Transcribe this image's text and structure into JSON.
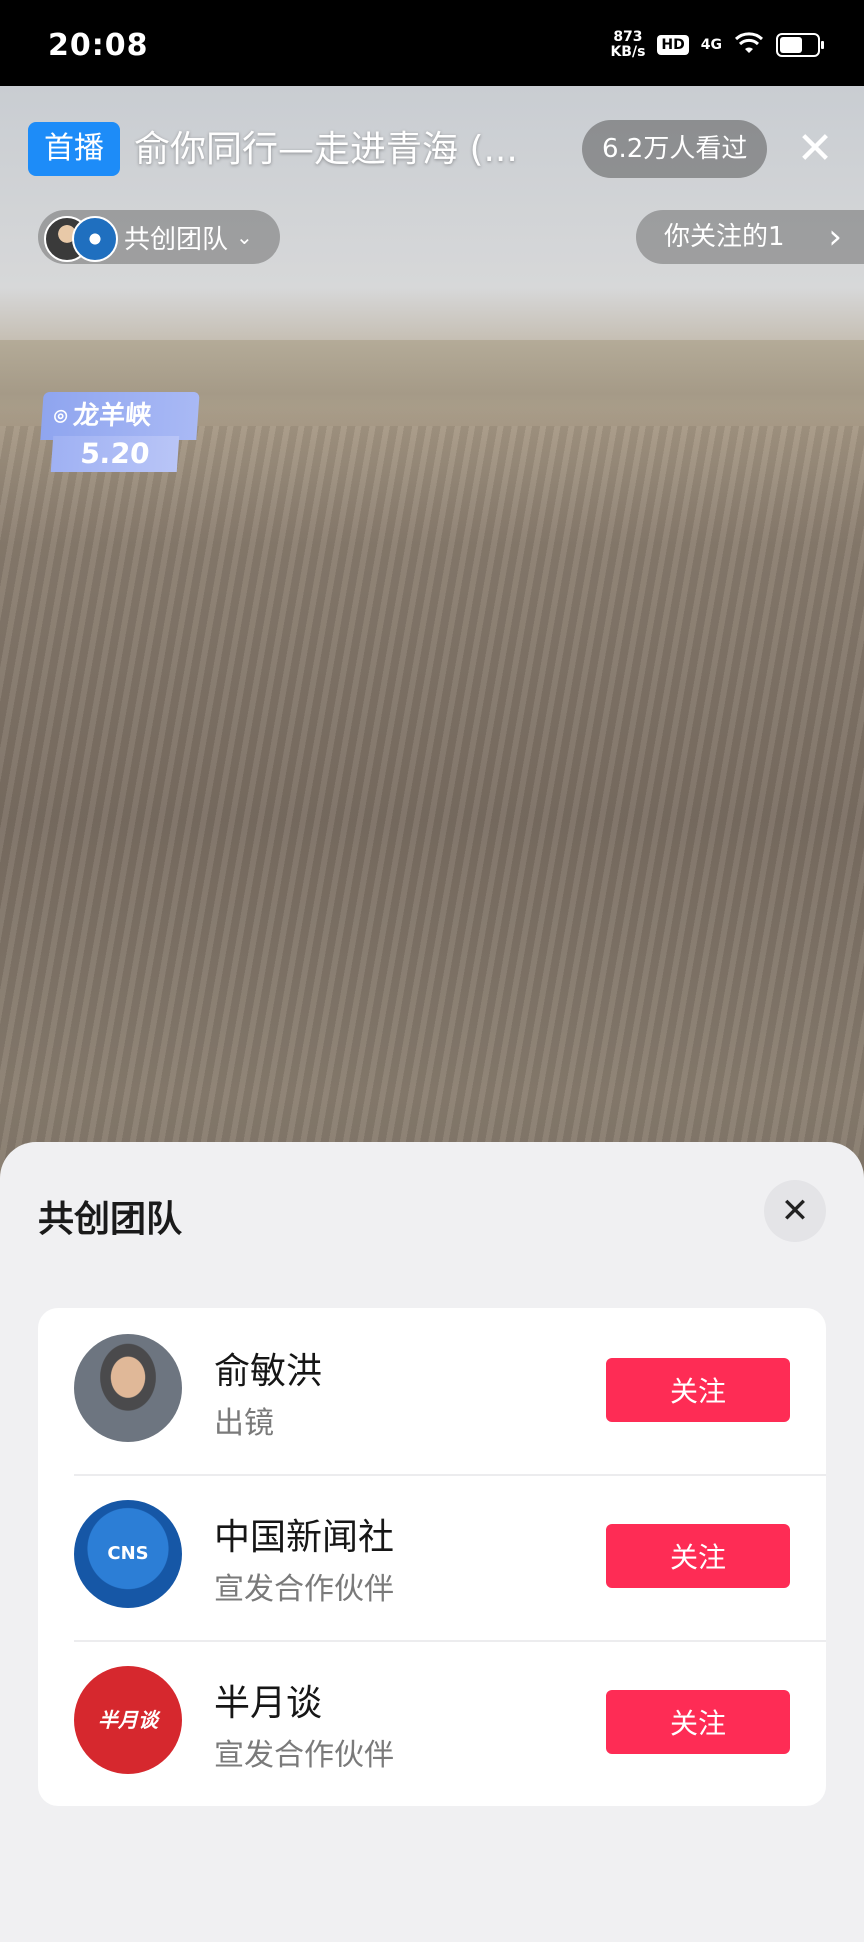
{
  "status_bar": {
    "time": "20:08",
    "net_speed_value": "873",
    "net_speed_unit": "KB/s",
    "hd": "HD",
    "network": "4G",
    "battery_level": 0.6
  },
  "stream": {
    "badge": "首播",
    "title": "俞你同行—走进青海 (...",
    "viewers": "6.2万人看过",
    "team_label": "共创团队",
    "following_label": "你关注的1",
    "location": {
      "name": "龙羊峡",
      "date": "5.20"
    }
  },
  "sheet": {
    "title": "共创团队",
    "members": [
      {
        "name": "俞敏洪",
        "role": "出镜",
        "follow_label": "关注"
      },
      {
        "name": "中国新闻社",
        "role": "宣发合作伙伴",
        "follow_label": "关注",
        "logo_text": "CNS"
      },
      {
        "name": "半月谈",
        "role": "宣发合作伙伴",
        "follow_label": "关注",
        "logo_text": "半月谈"
      }
    ]
  },
  "colors": {
    "follow": "#fe2c55",
    "badge": "#1d8cf8",
    "sheet_bg": "#f0f0f2"
  },
  "icons": {
    "close": "close-icon",
    "chevron_down": "chevron-down-icon",
    "chevron_right": "chevron-right-icon",
    "location": "location-pin-icon",
    "wifi": "wifi-icon",
    "battery": "battery-icon"
  }
}
